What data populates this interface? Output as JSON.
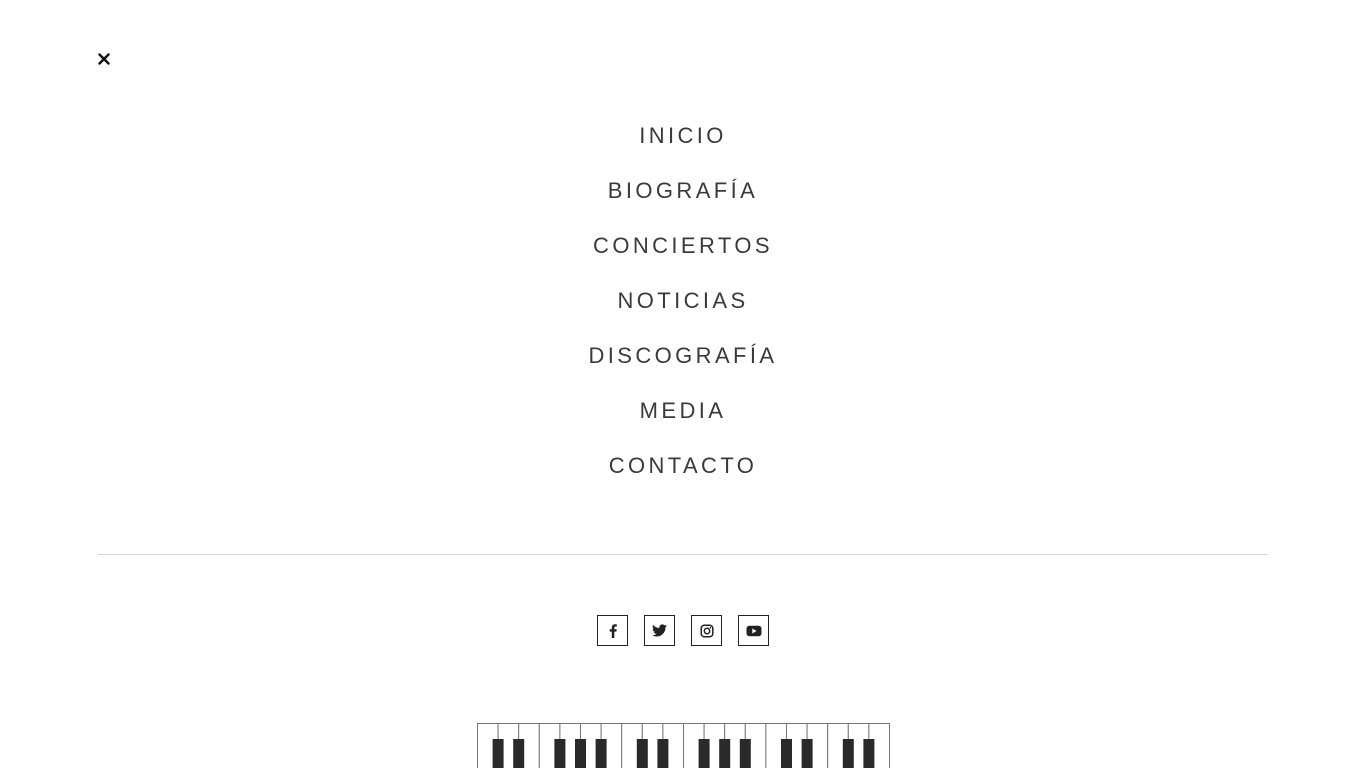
{
  "menu": {
    "close_icon": "close-icon",
    "items": [
      {
        "label": "INICIO"
      },
      {
        "label": "BIOGRAFÍA"
      },
      {
        "label": "CONCIERTOS"
      },
      {
        "label": "NOTICIAS"
      },
      {
        "label": "DISCOGRAFÍA"
      },
      {
        "label": "MEDIA"
      },
      {
        "label": "CONTACTO"
      }
    ]
  },
  "social": {
    "links": [
      {
        "icon": "facebook-icon"
      },
      {
        "icon": "twitter-icon"
      },
      {
        "icon": "instagram-icon"
      },
      {
        "icon": "youtube-icon"
      }
    ]
  },
  "decoration": {
    "icon": "piano-keys-icon"
  },
  "colors": {
    "text": "#3a3a3a",
    "divider": "#d6d6d6",
    "icon": "#222222",
    "background": "#ffffff"
  }
}
